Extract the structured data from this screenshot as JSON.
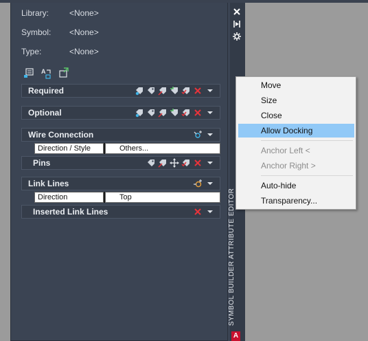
{
  "palette": {
    "title": "SYMBOL BUILDER ATTRIBUTE EDITOR",
    "logo": "A",
    "fields": [
      {
        "label": "Library:",
        "value": "<None>"
      },
      {
        "label": "Symbol:",
        "value": "<None>"
      },
      {
        "label": "Type:",
        "value": "<None>"
      }
    ],
    "toolbar_icons": [
      "insert-attribute-icon",
      "convert-text-icon",
      "insert-block-icon"
    ],
    "side_buttons": [
      "close-icon",
      "auto-hide-icon",
      "properties-icon"
    ]
  },
  "sections": {
    "required": {
      "title": "Required"
    },
    "optional": {
      "title": "Optional"
    },
    "wire_connection": {
      "title": "Wire Connection",
      "row": {
        "col1": "Direction / Style",
        "col2": "Others..."
      },
      "pins": {
        "title": "Pins"
      }
    },
    "link_lines": {
      "title": "Link Lines",
      "row": {
        "col1": "Direction",
        "col2": "Top"
      },
      "inserted": {
        "title": "Inserted Link Lines"
      }
    }
  },
  "context_menu": {
    "items": [
      {
        "label": "Move"
      },
      {
        "label": "Size"
      },
      {
        "label": "Close"
      },
      {
        "label": "Allow Docking",
        "highlighted": true
      },
      {
        "label": "Anchor Left  <",
        "disabled": true
      },
      {
        "label": "Anchor Right  >",
        "disabled": true
      },
      {
        "label": "Auto-hide"
      },
      {
        "label": "Transparency..."
      }
    ]
  },
  "colors": {
    "panel_bg": "#3b4453",
    "menu_highlight": "#91c9f7",
    "delete_red": "#e8333a",
    "autodesk_red": "#c8102e"
  }
}
